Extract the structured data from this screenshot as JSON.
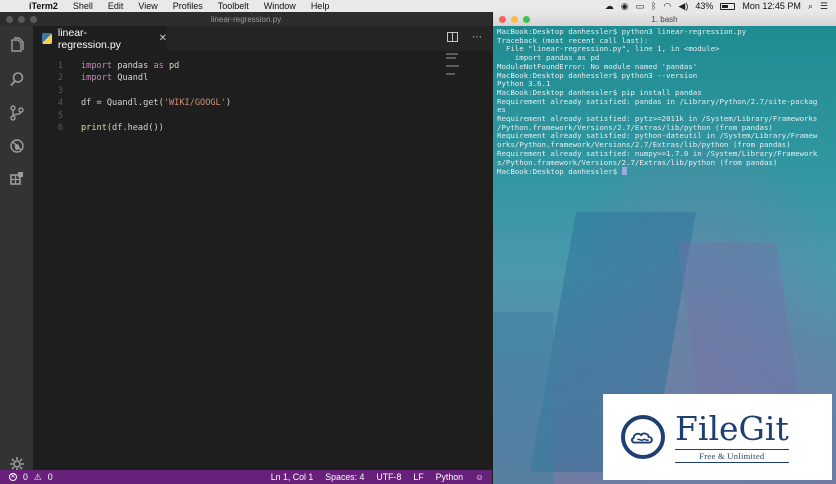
{
  "menubar": {
    "app_name": "iTerm2",
    "items": [
      "Shell",
      "Edit",
      "View",
      "Profiles",
      "Toolbelt",
      "Window",
      "Help"
    ],
    "battery_percent": "43%",
    "clock": "Mon 12:45 PM"
  },
  "vscode": {
    "window_title": "linear-regression.py",
    "tab": {
      "label": "linear-regression.py",
      "close": "✕"
    },
    "lines": [
      {
        "num": "1",
        "code": [
          {
            "t": "kw",
            "v": "import"
          },
          {
            "t": "id",
            "v": " pandas "
          },
          {
            "t": "kw",
            "v": "as"
          },
          {
            "t": "id",
            "v": " pd"
          }
        ]
      },
      {
        "num": "2",
        "code": [
          {
            "t": "kw",
            "v": "import"
          },
          {
            "t": "id",
            "v": " Quandl"
          }
        ]
      },
      {
        "num": "3",
        "code": []
      },
      {
        "num": "4",
        "code": [
          {
            "t": "id",
            "v": "df = Quandl.get("
          },
          {
            "t": "str",
            "v": "'WIKI/GOOGL'"
          },
          {
            "t": "id",
            "v": ")"
          }
        ]
      },
      {
        "num": "5",
        "code": []
      },
      {
        "num": "6",
        "code": [
          {
            "t": "fn",
            "v": "print"
          },
          {
            "t": "id",
            "v": "(df.head())"
          }
        ]
      }
    ],
    "status": {
      "errors": "0",
      "warnings": "0",
      "position": "Ln 1, Col 1",
      "spaces": "Spaces: 4",
      "encoding": "UTF-8",
      "eol": "LF",
      "language": "Python"
    }
  },
  "iterm": {
    "window_title": "1. bash",
    "terminal_lines": [
      "MacBook:Desktop danhessler$ python3 linear-regression.py",
      "Traceback (most recent call last):",
      "  File \"linear-regression.py\", line 1, in <module>",
      "    import pandas as pd",
      "ModuleNotFoundError: No module named 'pandas'",
      "MacBook:Desktop danhessler$ python3 --version",
      "Python 3.6.1",
      "MacBook:Desktop danhessler$ pip install pandas",
      "Requirement already satisfied: pandas in /Library/Python/2.7/site-packag",
      "es",
      "Requirement already satisfied: pytz>=2011k in /System/Library/Frameworks",
      "/Python.framework/Versions/2.7/Extras/lib/python (from pandas)",
      "Requirement already satisfied: python-dateutil in /System/Library/Framew",
      "orks/Python.framework/Versions/2.7/Extras/lib/python (from pandas)",
      "Requirement already satisfied: numpy>=1.7.0 in /System/Library/Framework",
      "s/Python.framework/Versions/2.7/Extras/lib/python (from pandas)",
      "MacBook:Desktop danhessler$ "
    ]
  },
  "watermark": {
    "name": "FileGit",
    "tagline": "Free & Unlimited"
  }
}
